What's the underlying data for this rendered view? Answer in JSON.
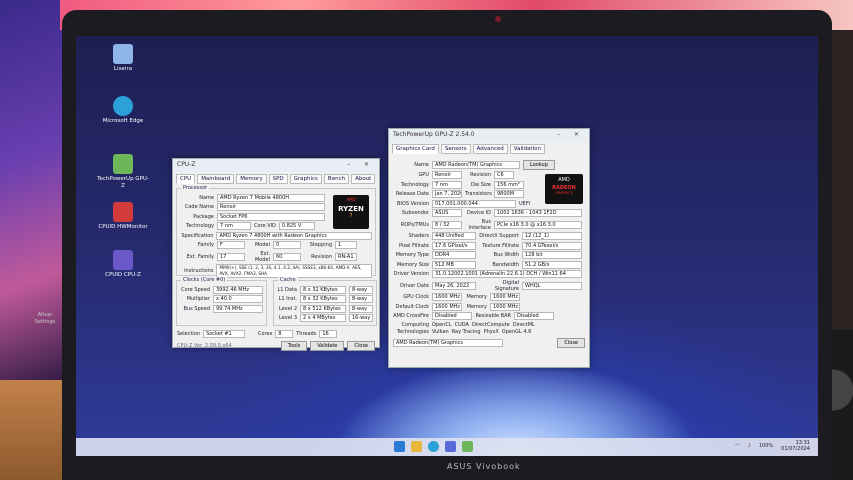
{
  "left_monitor": {
    "text_line1": "Ativar",
    "text_line2": "Settings"
  },
  "laptop": {
    "brand": "ASUS Vivobook"
  },
  "desktop_icons": [
    {
      "label": "Lixeira",
      "icon": "recycle-bin-icon",
      "color": "#8fb4e8"
    },
    {
      "label": "Microsoft Edge",
      "icon": "edge-icon",
      "color": "#2aa1d8"
    },
    {
      "label": "TechPowerUp GPU-Z",
      "icon": "gpuz-icon",
      "color": "#6db65a"
    },
    {
      "label": "CPUID HWMonitor",
      "icon": "hwmonitor-icon",
      "color": "#d23c3c"
    },
    {
      "label": "CPUID CPU-Z",
      "icon": "cpuz-icon",
      "color": "#6a58c8"
    }
  ],
  "cpuz": {
    "title": "CPU-Z",
    "tabs": [
      "CPU",
      "Mainboard",
      "Memory",
      "SPD",
      "Graphics",
      "Bench",
      "About"
    ],
    "processor_group": "Processor",
    "name_label": "Name",
    "name": "AMD Ryzen 7 Mobile 4800H",
    "codename_label": "Code Name",
    "codename": "Renoir",
    "package_label": "Package",
    "package": "Socket FP6",
    "technology_label": "Technology",
    "technology": "7 nm",
    "voltage_label": "Core VID",
    "voltage": "0.825 V",
    "spec_label": "Specification",
    "spec": "AMD Ryzen 7 4800H with Radeon Graphics",
    "family_label": "Family",
    "family": "F",
    "model_label": "Model",
    "model": "0",
    "stepping_label": "Stepping",
    "stepping": "1",
    "extfamily_label": "Ext. Family",
    "extfamily": "17",
    "extmodel_label": "Ext. Model",
    "extmodel": "60",
    "revision_label": "Revision",
    "revision": "RN-A1",
    "instr_label": "Instructions",
    "instr": "MMX(+), SSE (1, 2, 3, 3S, 4.1, 4.2, 4A), SSSE3, x86-64, AMD-V, AES, AVX, AVX2, FMA3, SHA",
    "clocks_group": "Clocks (Core #0)",
    "cache_group": "Cache",
    "core_speed_label": "Core Speed",
    "core_speed": "3992.46 MHz",
    "multiplier_label": "Multiplier",
    "multiplier": "x 40.0",
    "bus_label": "Bus Speed",
    "bus": "99.74 MHz",
    "l1d_label": "L1 Data",
    "l1d": "8 x 32 KBytes",
    "l1d_way": "8-way",
    "l1i_label": "L1 Inst.",
    "l1i": "8 x 32 KBytes",
    "l1i_way": "8-way",
    "l2_label": "Level 2",
    "l2": "8 x 512 KBytes",
    "l2_way": "8-way",
    "l3_label": "Level 3",
    "l3": "2 x 4 MBytes",
    "l3_way": "16-way",
    "selection_label": "Selection",
    "selection": "Socket #1",
    "cores_label": "Cores",
    "cores": "8",
    "threads_label": "Threads",
    "threads": "16",
    "version": "CPU-Z  Ver. 2.09.0.x64",
    "tools_button": "Tools",
    "validate_button": "Validate",
    "close_button": "Close",
    "badge_brand": "AMD",
    "badge_text": "RYZEN",
    "badge_tier": "7"
  },
  "gpuz": {
    "title": "TechPowerUp GPU-Z 2.54.0",
    "tabs": [
      "Graphics Card",
      "Sensors",
      "Advanced",
      "Validation"
    ],
    "name_label": "Name",
    "name": "AMD Radeon(TM) Graphics",
    "lookup_button": "Lookup",
    "gpu_label": "GPU",
    "gpu": "Renoir",
    "revision_label": "Revision",
    "revision": "C6",
    "tech_label": "Technology",
    "tech": "7 nm",
    "die_label": "Die Size",
    "die": "156 mm²",
    "release_label": "Release Date",
    "release": "Jan 7, 2020",
    "transistors_label": "Transistors",
    "transistors": "9800M",
    "bios_label": "BIOS Version",
    "bios": "017.001.000.044",
    "uefi_label": "UEFI",
    "subvendor_label": "Subvendor",
    "subvendor": "ASUS",
    "deviceid_label": "Device ID",
    "deviceid": "1002 1636 - 1043 1F2D",
    "rops_label": "ROPs/TMUs",
    "rops": "8 / 32",
    "bus_label": "Bus Interface",
    "bus": "PCIe x16 3.0 @ x16 3.0",
    "shaders_label": "Shaders",
    "shaders": "448 Unified",
    "dx_label": "DirectX Support",
    "dx": "12 (12_1)",
    "pixel_label": "Pixel Fillrate",
    "pixel": "17.6 GPixel/s",
    "texture_label": "Texture Fillrate",
    "texture": "70.4 GTexel/s",
    "memtype_label": "Memory Type",
    "memtype": "DDR4",
    "buswidth_label": "Bus Width",
    "buswidth": "128 bit",
    "memsize_label": "Memory Size",
    "memsize": "512 MB",
    "bandwidth_label": "Bandwidth",
    "bandwidth": "51.2 GB/s",
    "driver_label": "Driver Version",
    "driver": "31.0.12002.1001 (Adrenalin 22.6.1) DCH / Win11 64",
    "driverdate_label": "Driver Date",
    "driverdate": "May 26, 2022",
    "sig_label": "Digital Signature",
    "sig": "WHQL",
    "gpuclock_label": "GPU Clock",
    "gpuclock": "1600 MHz",
    "memory_label": "Memory",
    "memory": "1600 MHz",
    "default_label": "Default Clock",
    "default": "1600 MHz",
    "memory2": "1600 MHz",
    "crossfire_label": "AMD CrossFire",
    "crossfire": "Disabled",
    "resizable_label": "Resizable BAR",
    "resizable": "Disabled",
    "computing_label": "Computing",
    "computing": [
      "OpenCL",
      "CUDA",
      "DirectCompute",
      "DirectML"
    ],
    "tech2_label": "Technologies",
    "technologies": [
      "Vulkan",
      "Ray Tracing",
      "PhysX",
      "OpenGL 4.6"
    ],
    "footer_select": "AMD Radeon(TM) Graphics",
    "close_button": "Close",
    "logo_brand": "AMD",
    "logo_text": "RADEON",
    "logo_sub": "GRAPHICS"
  },
  "taskbar": {
    "battery": "100%",
    "time": "13:31",
    "date": "01/07/2024"
  }
}
